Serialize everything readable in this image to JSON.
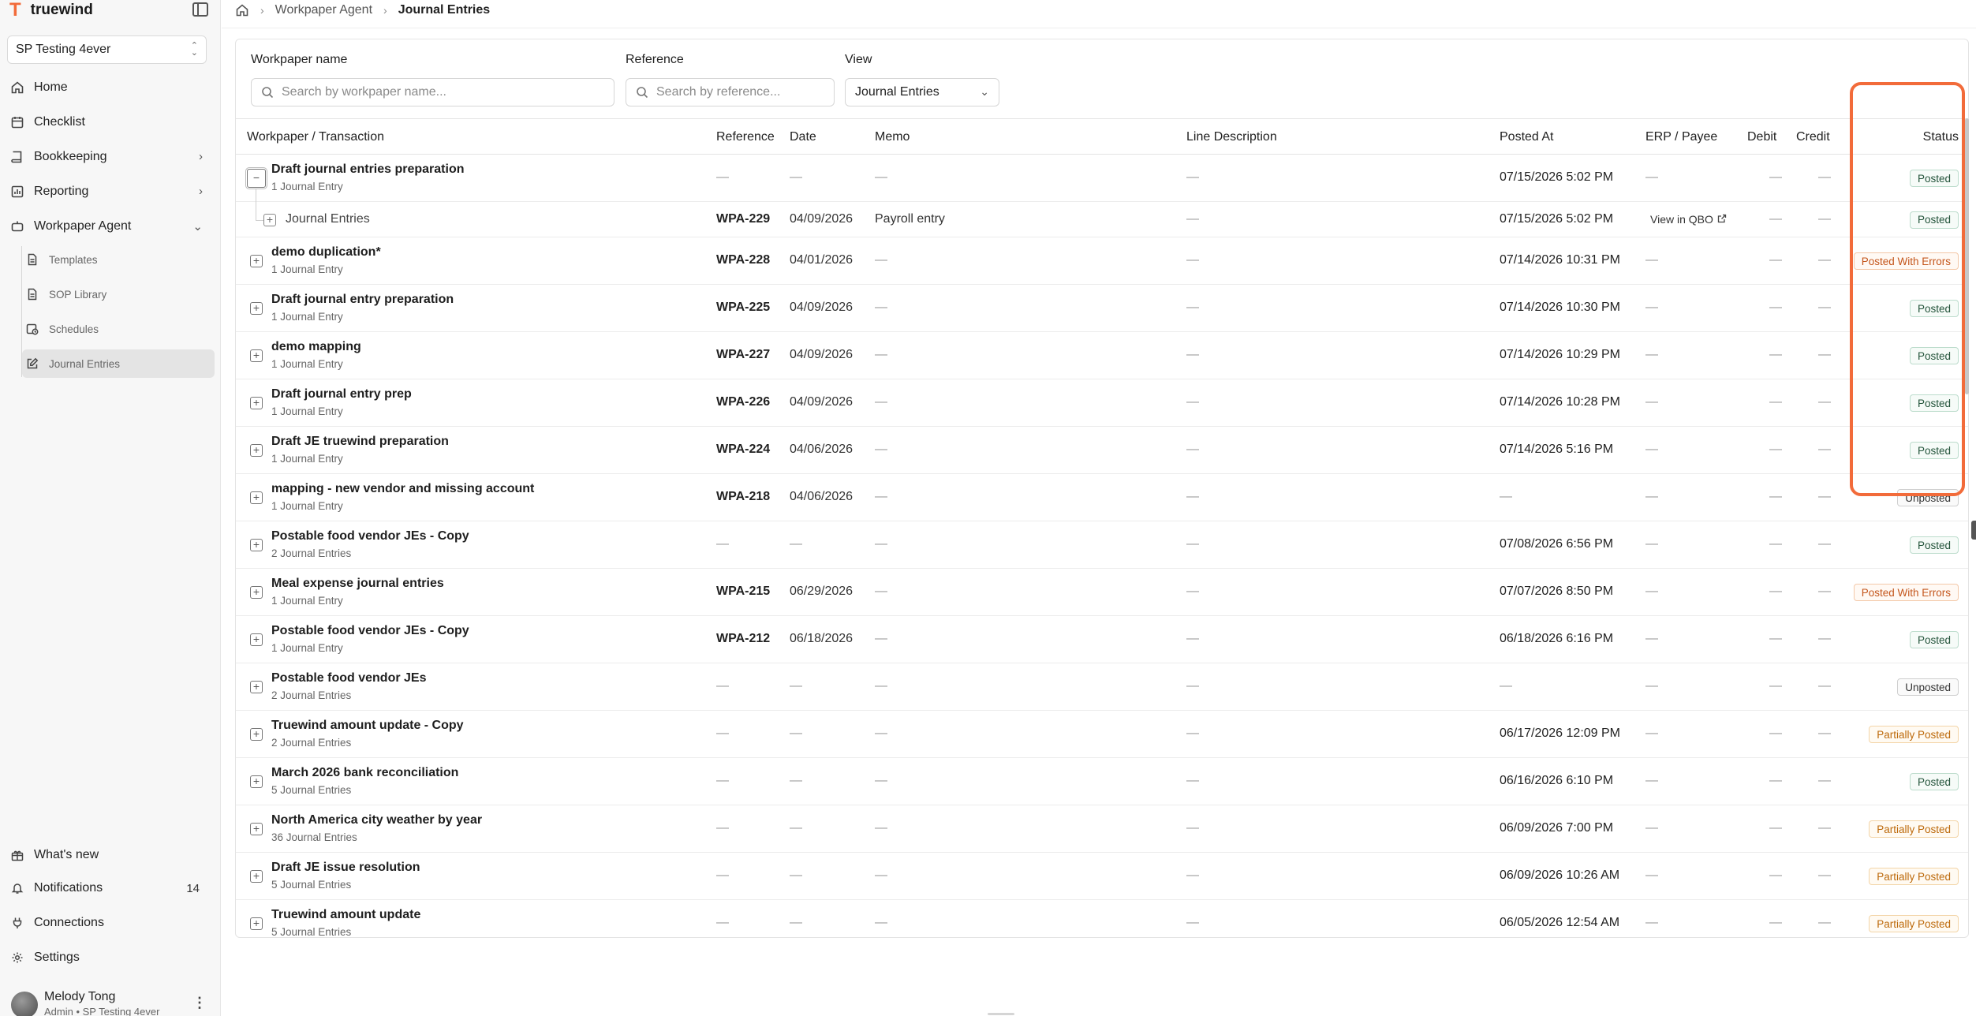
{
  "app": {
    "brand_mark": "T",
    "brand_name": "truewind",
    "org": "SP Testing 4ever",
    "accent_color": "#f26b3a"
  },
  "sidebar": {
    "items": [
      {
        "label": "Home",
        "icon": "home-icon"
      },
      {
        "label": "Checklist",
        "icon": "calendar-icon"
      },
      {
        "label": "Bookkeeping",
        "icon": "book-icon"
      },
      {
        "label": "Reporting",
        "icon": "chart-icon"
      },
      {
        "label": "Workpaper Agent",
        "icon": "robot-icon"
      },
      {
        "label": "Templates",
        "icon": "document-icon"
      },
      {
        "label": "SOP Library",
        "icon": "document-icon"
      },
      {
        "label": "Schedules",
        "icon": "clock-calendar-icon"
      },
      {
        "label": "Journal Entries",
        "icon": "edit-icon"
      }
    ],
    "bottom": [
      {
        "label": "What's new",
        "icon": "gift-icon"
      },
      {
        "label": "Notifications",
        "icon": "bell-icon",
        "count": "14"
      },
      {
        "label": "Connections",
        "icon": "plug-icon"
      },
      {
        "label": "Settings",
        "icon": "gear-icon"
      }
    ],
    "user": {
      "name": "Melody Tong",
      "role": "Admin • SP Testing 4ever"
    }
  },
  "breadcrumb": {
    "parent": "Workpaper Agent",
    "current": "Journal Entries"
  },
  "filters": {
    "workpaper_label": "Workpaper name",
    "workpaper_placeholder": "Search by workpaper name...",
    "reference_label": "Reference",
    "reference_placeholder": "Search by reference...",
    "view_label": "View",
    "view_value": "Journal Entries"
  },
  "table": {
    "columns": {
      "workpaper": "Workpaper / Transaction",
      "reference": "Reference",
      "date": "Date",
      "memo": "Memo",
      "line_description": "Line Description",
      "posted_at": "Posted At",
      "erp": "ERP / Payee",
      "debit": "Debit",
      "credit": "Credit",
      "status": "Status"
    },
    "dash": "—",
    "rows": [
      {
        "title": "Draft journal entries preparation",
        "sub": "1 Journal Entry",
        "ref": "—",
        "date": "—",
        "memo": "—",
        "line": "—",
        "posted": "07/15/2026 5:02 PM",
        "erp": "—",
        "debit": "—",
        "credit": "—",
        "status": "Posted",
        "expanded": true
      },
      {
        "child": true,
        "title": "Journal Entries",
        "ref": "WPA-229",
        "date": "04/09/2026",
        "memo": "Payroll entry",
        "line": "—",
        "posted": "07/15/2026 5:02 PM",
        "erp": "View in QBO",
        "debit": "—",
        "credit": "—",
        "status": "Posted"
      },
      {
        "title": "demo duplication*",
        "sub": "1 Journal Entry",
        "ref": "WPA-228",
        "date": "04/01/2026",
        "memo": "—",
        "line": "—",
        "posted": "07/14/2026 10:31 PM",
        "erp": "—",
        "debit": "—",
        "credit": "—",
        "status": "Posted With Errors"
      },
      {
        "title": "Draft journal entry preparation",
        "sub": "1 Journal Entry",
        "ref": "WPA-225",
        "date": "04/09/2026",
        "memo": "—",
        "line": "—",
        "posted": "07/14/2026 10:30 PM",
        "erp": "—",
        "debit": "—",
        "credit": "—",
        "status": "Posted"
      },
      {
        "title": "demo mapping",
        "sub": "1 Journal Entry",
        "ref": "WPA-227",
        "date": "04/09/2026",
        "memo": "—",
        "line": "—",
        "posted": "07/14/2026 10:29 PM",
        "erp": "—",
        "debit": "—",
        "credit": "—",
        "status": "Posted"
      },
      {
        "title": "Draft journal entry prep",
        "sub": "1 Journal Entry",
        "ref": "WPA-226",
        "date": "04/09/2026",
        "memo": "—",
        "line": "—",
        "posted": "07/14/2026 10:28 PM",
        "erp": "—",
        "debit": "—",
        "credit": "—",
        "status": "Posted"
      },
      {
        "title": "Draft JE truewind preparation",
        "sub": "1 Journal Entry",
        "ref": "WPA-224",
        "date": "04/06/2026",
        "memo": "—",
        "line": "—",
        "posted": "07/14/2026 5:16 PM",
        "erp": "—",
        "debit": "—",
        "credit": "—",
        "status": "Posted"
      },
      {
        "title": "mapping - new vendor and missing account",
        "sub": "1 Journal Entry",
        "ref": "WPA-218",
        "date": "04/06/2026",
        "memo": "—",
        "line": "—",
        "posted": "—",
        "erp": "—",
        "debit": "—",
        "credit": "—",
        "status": "Unposted"
      },
      {
        "title": "Postable food vendor JEs - Copy",
        "sub": "2 Journal Entries",
        "ref": "—",
        "date": "—",
        "memo": "—",
        "line": "—",
        "posted": "07/08/2026 6:56 PM",
        "erp": "—",
        "debit": "—",
        "credit": "—",
        "status": "Posted"
      },
      {
        "title": "Meal expense journal entries",
        "sub": "1 Journal Entry",
        "ref": "WPA-215",
        "date": "06/29/2026",
        "memo": "—",
        "line": "—",
        "posted": "07/07/2026 8:50 PM",
        "erp": "—",
        "debit": "—",
        "credit": "—",
        "status": "Posted With Errors"
      },
      {
        "title": "Postable food vendor JEs - Copy",
        "sub": "1 Journal Entry",
        "ref": "WPA-212",
        "date": "06/18/2026",
        "memo": "—",
        "line": "—",
        "posted": "06/18/2026 6:16 PM",
        "erp": "—",
        "debit": "—",
        "credit": "—",
        "status": "Posted"
      },
      {
        "title": "Postable food vendor JEs",
        "sub": "2 Journal Entries",
        "ref": "—",
        "date": "—",
        "memo": "—",
        "line": "—",
        "posted": "—",
        "erp": "—",
        "debit": "—",
        "credit": "—",
        "status": "Unposted"
      },
      {
        "title": "Truewind amount update - Copy",
        "sub": "2 Journal Entries",
        "ref": "—",
        "date": "—",
        "memo": "—",
        "line": "—",
        "posted": "06/17/2026 12:09 PM",
        "erp": "—",
        "debit": "—",
        "credit": "—",
        "status": "Partially Posted"
      },
      {
        "title": "March 2026 bank reconciliation",
        "sub": "5 Journal Entries",
        "ref": "—",
        "date": "—",
        "memo": "—",
        "line": "—",
        "posted": "06/16/2026 6:10 PM",
        "erp": "—",
        "debit": "—",
        "credit": "—",
        "status": "Posted"
      },
      {
        "title": "North America city weather by year",
        "sub": "36 Journal Entries",
        "ref": "—",
        "date": "—",
        "memo": "—",
        "line": "—",
        "posted": "06/09/2026 7:00 PM",
        "erp": "—",
        "debit": "—",
        "credit": "—",
        "status": "Partially Posted"
      },
      {
        "title": "Draft JE issue resolution",
        "sub": "5 Journal Entries",
        "ref": "—",
        "date": "—",
        "memo": "—",
        "line": "—",
        "posted": "06/09/2026 10:26 AM",
        "erp": "—",
        "debit": "—",
        "credit": "—",
        "status": "Partially Posted"
      },
      {
        "title": "Truewind amount update",
        "sub": "5 Journal Entries",
        "ref": "—",
        "date": "—",
        "memo": "—",
        "line": "—",
        "posted": "06/05/2026 12:54 AM",
        "erp": "—",
        "debit": "—",
        "credit": "—",
        "status": "Partially Posted"
      }
    ]
  }
}
